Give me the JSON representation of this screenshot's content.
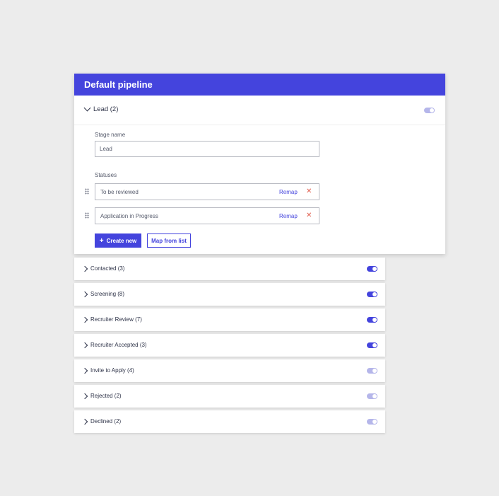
{
  "pipeline": {
    "title": "Default pipeline",
    "expanded_stage": {
      "label": "Lead (2)",
      "toggle": "off",
      "stage_name_label": "Stage name",
      "stage_name_value": "Lead",
      "statuses_label": "Statuses",
      "statuses": [
        {
          "name": "To be reviewed",
          "remap_label": "Remap",
          "remove_icon": "close-icon"
        },
        {
          "name": "Application in Progress",
          "remap_label": "Remap",
          "remove_icon": "close-icon"
        }
      ],
      "create_button_label": "Create new",
      "map_button_label": "Map from list"
    },
    "stages": [
      {
        "label": "Contacted (3)",
        "toggle": "on"
      },
      {
        "label": "Screening (8)",
        "toggle": "on"
      },
      {
        "label": "Recruiter Review (7)",
        "toggle": "on"
      },
      {
        "label": "Recruiter Accepted (3)",
        "toggle": "on"
      },
      {
        "label": "Invite to Apply (4)",
        "toggle": "off"
      },
      {
        "label": "Rejected (2)",
        "toggle": "off"
      },
      {
        "label": "Declined (2)",
        "toggle": "off"
      }
    ]
  },
  "colors": {
    "accent": "#4444dd",
    "toggle_off": "#b5b6ea",
    "remove": "#e05a4a",
    "background": "#ececec"
  }
}
